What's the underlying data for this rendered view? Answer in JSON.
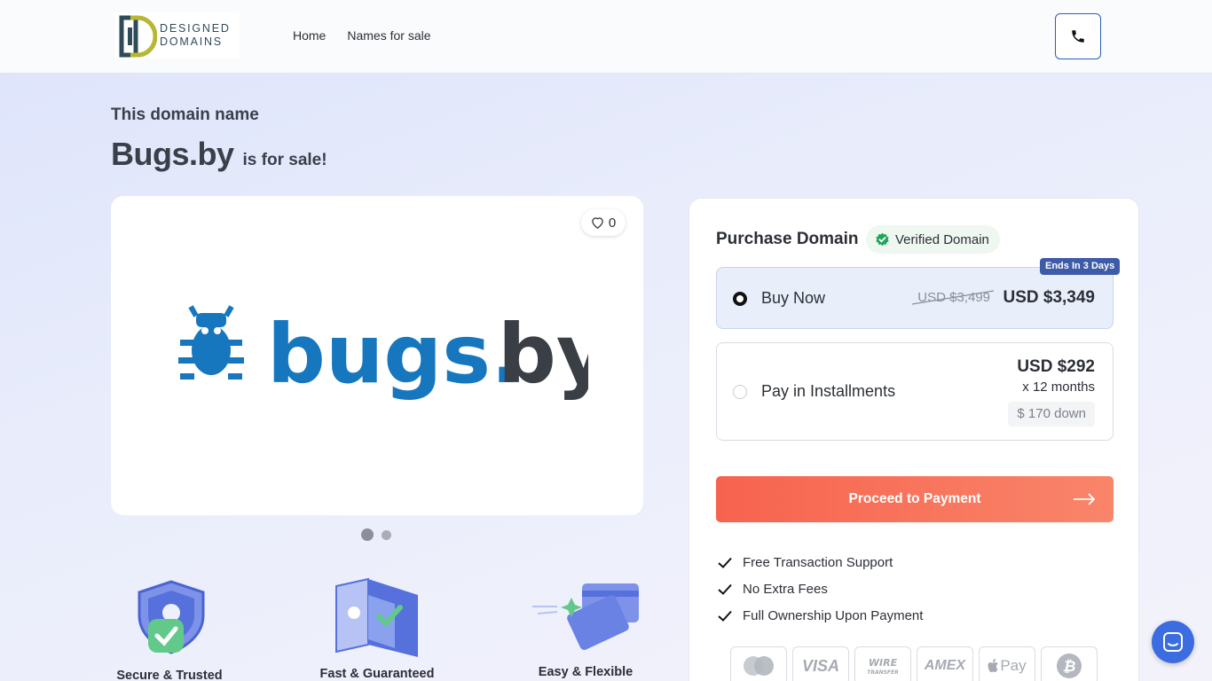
{
  "brand": {
    "name_line1": "DESIGNED",
    "name_line2": "DOMAINS"
  },
  "nav": {
    "home": "Home",
    "names_for_sale": "Names for sale"
  },
  "hero": {
    "subtitle": "This domain name",
    "domain": "Bugs.by",
    "tagline": "is for sale!"
  },
  "image_card": {
    "likes": "0",
    "logo_text_main": "bugs.",
    "logo_text_ext": "by",
    "active_slide": 1,
    "slide_count": 2
  },
  "features": [
    {
      "label": "Secure & Trusted"
    },
    {
      "label": "Fast & Guaranteed"
    },
    {
      "label": "Easy & Flexible"
    }
  ],
  "purchase": {
    "title": "Purchase Domain",
    "verified_label": "Verified Domain",
    "ends_badge": "Ends In 3 Days",
    "buy_now": {
      "label": "Buy Now",
      "old_price": "USD $3,499",
      "price": "USD $3,349",
      "selected": true
    },
    "installments": {
      "label": "Pay in Installments",
      "price": "USD $292",
      "months": "x 12 months",
      "down": "$ 170 down",
      "selected": false
    },
    "proceed_label": "Proceed to Payment",
    "benefits": [
      "Free Transaction Support",
      "No Extra Fees",
      "Full Ownership Upon Payment"
    ],
    "payment_methods": [
      "mastercard",
      "VISA",
      "WIRE TRANSFER",
      "AMEX",
      "Pay",
      "bitcoin"
    ]
  },
  "colors": {
    "accent_blue": "#3b6de0",
    "proceed_start": "#f7634e",
    "proceed_end": "#f9856a",
    "logo_blue": "#1677be",
    "logo_dark": "#3a3f46",
    "verified_green": "#22a559",
    "badge_navy": "#3d5ba8"
  }
}
